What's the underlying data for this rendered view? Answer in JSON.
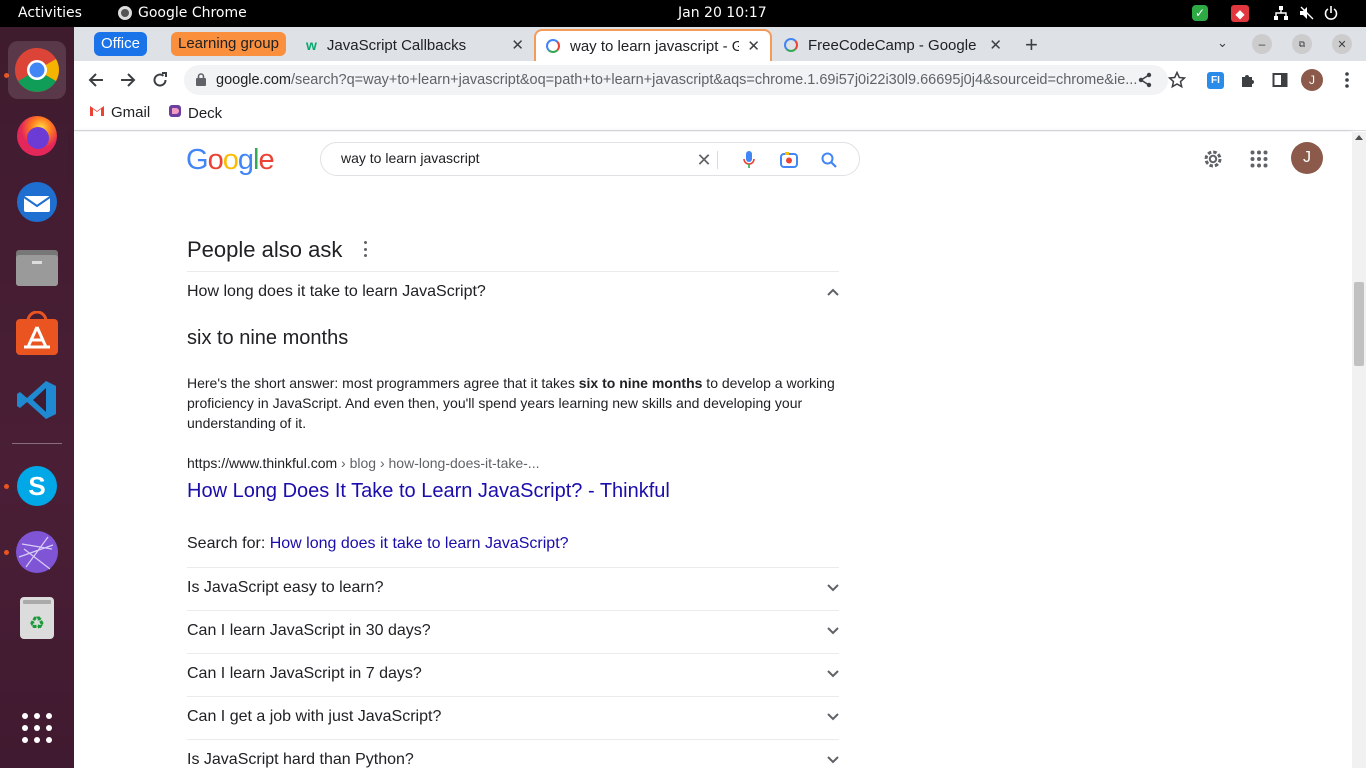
{
  "topbar": {
    "activities": "Activities",
    "app_name": "Google Chrome",
    "clock": "Jan 20  10:17"
  },
  "dock": {
    "items": [
      "chrome-icon",
      "firefox-icon",
      "thunderbird-icon",
      "files-icon",
      "software-center-icon",
      "vscode-icon",
      "skype-icon",
      "web-app-icon",
      "trash-icon",
      "show-apps-icon"
    ]
  },
  "browser": {
    "tab_groups": [
      {
        "label": "Office",
        "color": "#1a73e8"
      },
      {
        "label": "Learning group",
        "color": "#fa903e"
      }
    ],
    "tabs": [
      {
        "title": "JavaScript Callbacks"
      },
      {
        "title": "way to learn javascript - G"
      },
      {
        "title": "FreeCodeCamp - Google S"
      }
    ],
    "url_domain": "google.com",
    "url_rest": "/search?q=way+to+learn+javascript&oq=path+to+learn+javascript&aqs=chrome.1.69i57j0i22i30l9.66695j0j4&sourceid=chrome&ie...",
    "profile_initial": "J",
    "extension_label": "FI",
    "bookmarks": [
      {
        "label": "Gmail"
      },
      {
        "label": "Deck"
      }
    ]
  },
  "google": {
    "logo": "Google",
    "query": "way to learn javascript",
    "profile_initial": "J",
    "paa_title": "People also ask",
    "expanded_question": "How long does it take to learn JavaScript?",
    "answer_heading": "six to nine months",
    "snippet_before": "Here's the short answer: most programmers agree that it takes ",
    "snippet_bold": "six to nine months",
    "snippet_after": " to develop a working proficiency in JavaScript. And even then, you'll spend years learning new skills and developing your understanding of it.",
    "cite_domain": "https://www.thinkful.com",
    "cite_crumb": " › blog › how-long-does-it-take-...",
    "result_title": "How Long Does It Take to Learn JavaScript? - Thinkful",
    "search_for_label": "Search for: ",
    "search_for_link": "How long does it take to learn JavaScript?",
    "questions": [
      "Is JavaScript easy to learn?",
      "Can I learn JavaScript in 30 days?",
      "Can I learn JavaScript in 7 days?",
      "Can I get a job with just JavaScript?",
      "Is JavaScript hard than Python?"
    ]
  },
  "colors": {
    "accent_orange": "#e95420",
    "link_blue": "#1a0dab",
    "active_tab_border": "#f49b5a"
  }
}
